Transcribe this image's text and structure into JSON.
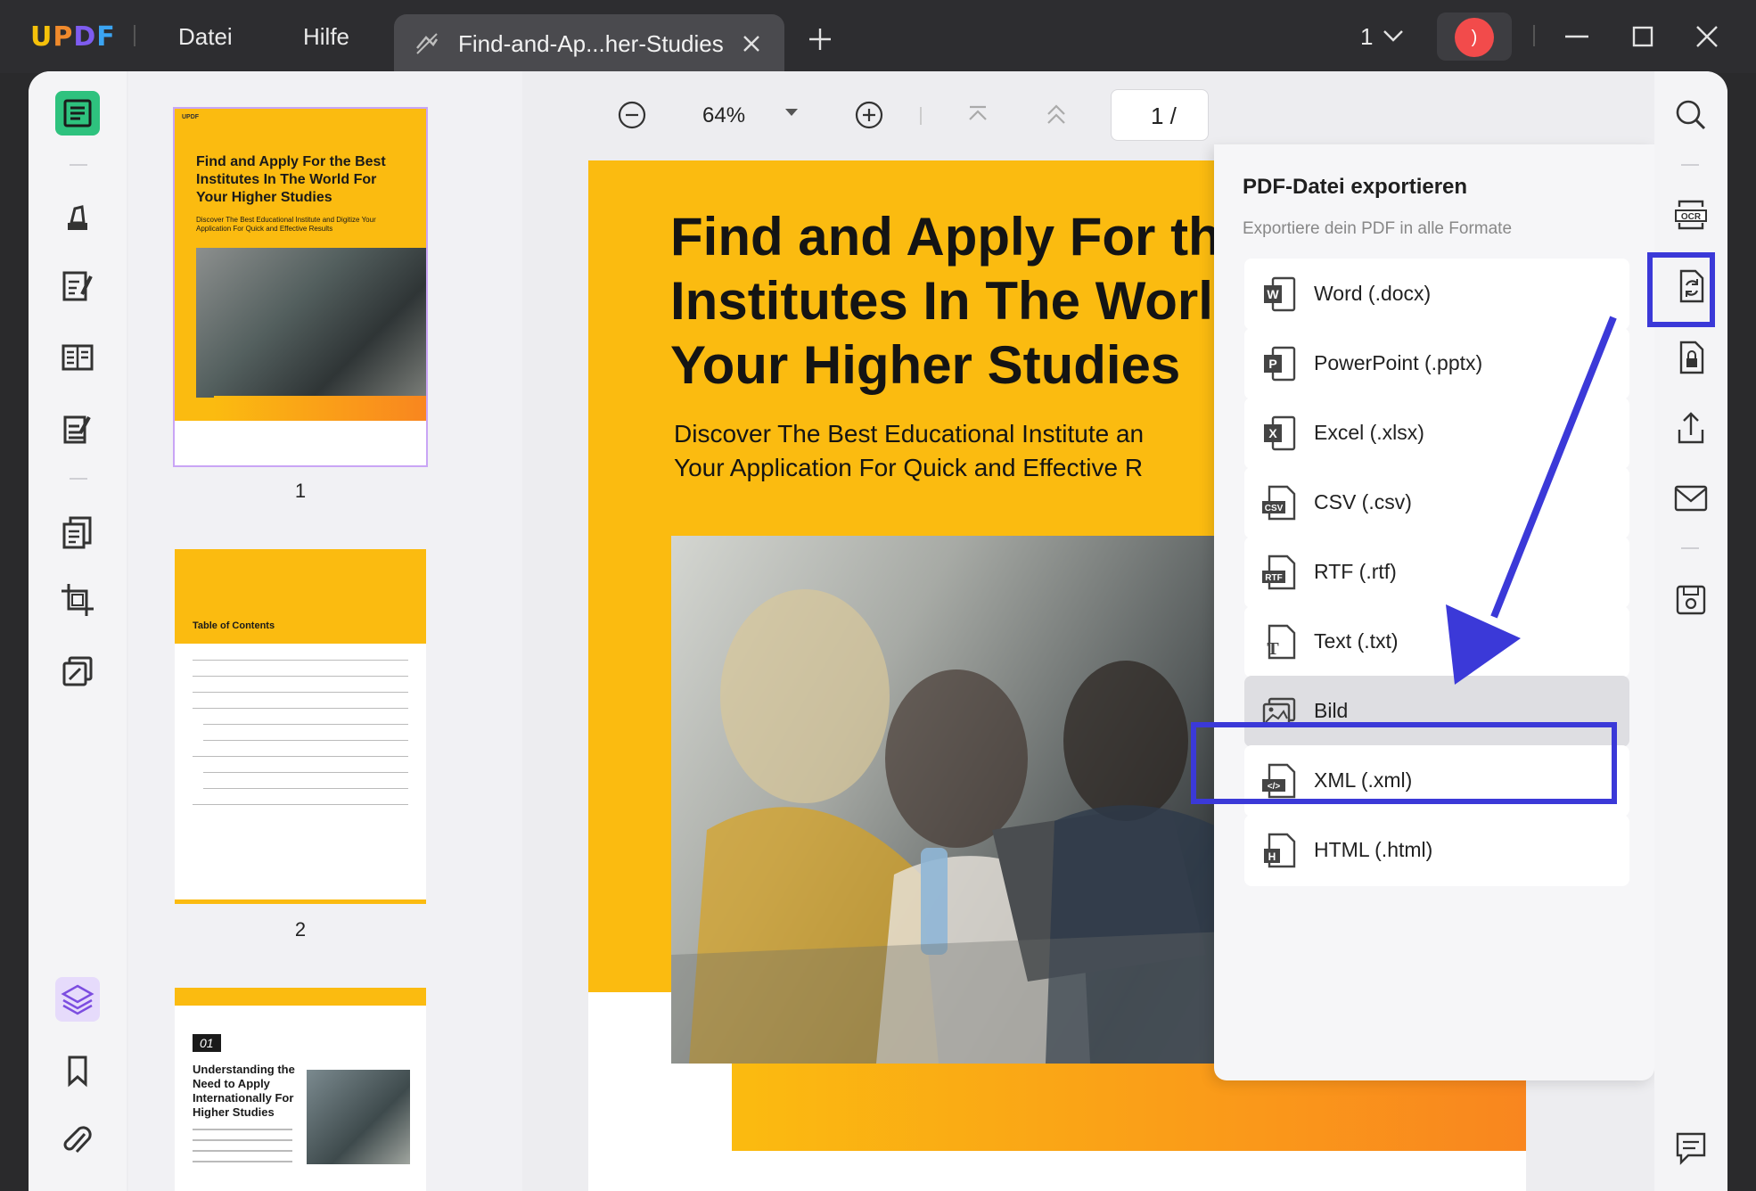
{
  "app": {
    "logo": "UPDF",
    "menu": [
      "Datei",
      "Hilfe"
    ],
    "tab_title": "Find-and-Ap...her-Studies",
    "page_count": "1",
    "avatar_initial": ")"
  },
  "toolbar": {
    "zoom": "64%",
    "page_current": "1 /"
  },
  "thumbnails": {
    "page1": {
      "logo": "UPDF",
      "title": "Find and Apply For the Best Institutes In The World For Your Higher Studies",
      "subtitle": "Discover The Best Educational Institute and Digitize Your Application For Quick and Effective Results",
      "number": "1"
    },
    "page2": {
      "title": "Table of Contents",
      "number": "2"
    },
    "page3": {
      "badge": "01",
      "title": "Understanding the Need to Apply Internationally For Higher Studies"
    }
  },
  "document": {
    "heading": "Find and Apply For th\nInstitutes In The Worl\nYour Higher Studies",
    "subheading": "Discover The Best Educational Institute an\nYour Application For Quick and Effective R"
  },
  "export_panel": {
    "title": "PDF-Datei exportieren",
    "subtitle": "Exportiere dein PDF in alle Formate",
    "formats": [
      {
        "label": "Word (.docx)",
        "icon": "word-icon"
      },
      {
        "label": "PowerPoint (.pptx)",
        "icon": "powerpoint-icon"
      },
      {
        "label": "Excel (.xlsx)",
        "icon": "excel-icon"
      },
      {
        "label": "CSV (.csv)",
        "icon": "csv-icon"
      },
      {
        "label": "RTF (.rtf)",
        "icon": "rtf-icon"
      },
      {
        "label": "Text (.txt)",
        "icon": "text-icon"
      },
      {
        "label": "Bild",
        "icon": "image-icon",
        "selected": true
      },
      {
        "label": "XML (.xml)",
        "icon": "xml-icon"
      },
      {
        "label": "HTML (.html)",
        "icon": "html-icon"
      }
    ]
  },
  "colors": {
    "accent_highlight": "#3b39d8",
    "brand_yellow": "#fbbb10",
    "active_green": "#2ec27e"
  }
}
